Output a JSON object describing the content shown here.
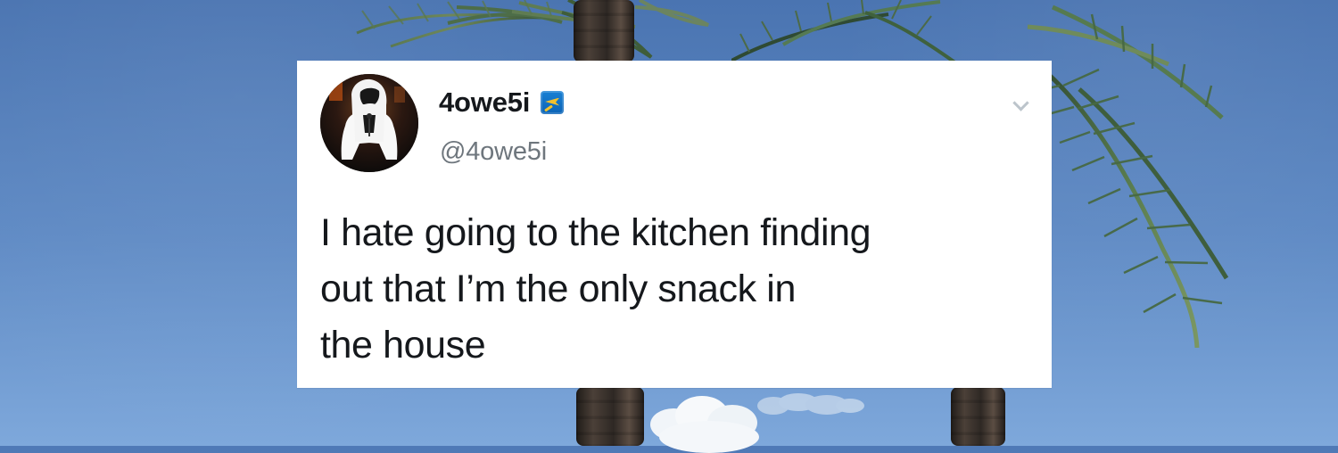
{
  "tweet": {
    "display_name": "4owe5i",
    "handle": "@4owe5i",
    "text": "I hate going to the kitchen finding\nout that I’m the only snack in\nthe house",
    "verified_icon": "verified-badge-icon",
    "menu_icon": "chevron-down-icon"
  },
  "colors": {
    "card_background": "#ffffff",
    "primary_text": "#15181c",
    "secondary_text": "#6e767d",
    "sky_blue": "#5b88c4",
    "palm_green": "#466544"
  }
}
